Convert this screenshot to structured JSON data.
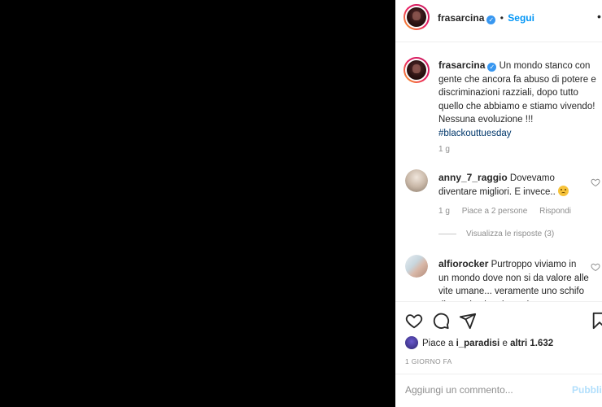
{
  "post": {
    "author": "frasarcina",
    "follow_label": "Segui",
    "separator": "•",
    "more_label": "•",
    "caption": {
      "username": "frasarcina",
      "text": "Un mondo stanco con gente che ancora fa abuso di potere e discriminazioni razziali, dopo tutto quello che abbiamo e stiamo vivendo! Nessuna evoluzione !!!",
      "hashtag": "#blackouttuesday",
      "time": "1 g"
    },
    "comments": [
      {
        "username": "anny_7_raggio",
        "text": "Dovevamo diventare migliori. E invece..",
        "time": "1 g",
        "likes": "Piace a 2 persone",
        "reply": "Rispondi",
        "view_replies": "Visualizza le risposte (3)"
      },
      {
        "username": "alfiorocker",
        "text": "Purtroppo viviamo in un mondo dove non si da valore alle vite umane... veramente uno schifo di mondo che vive nel"
      }
    ],
    "likes_text_prefix": "Piace a ",
    "likes_user": "i_paradisi",
    "likes_text_middle": " e ",
    "likes_others": "altri 1.632",
    "date": "1 GIORNO FA",
    "comment_placeholder": "Aggiungi un commento...",
    "publish_label": "Pubblica"
  },
  "colors": {
    "accent": "#0095f6",
    "hashtag": "#00376b",
    "muted": "#8e8e8e",
    "publish_disabled": "#b2dffc"
  },
  "icons": {
    "verified": "verified-badge-icon",
    "like": "heart-icon",
    "comment": "comment-icon",
    "share": "paper-plane-icon",
    "save": "bookmark-icon"
  }
}
